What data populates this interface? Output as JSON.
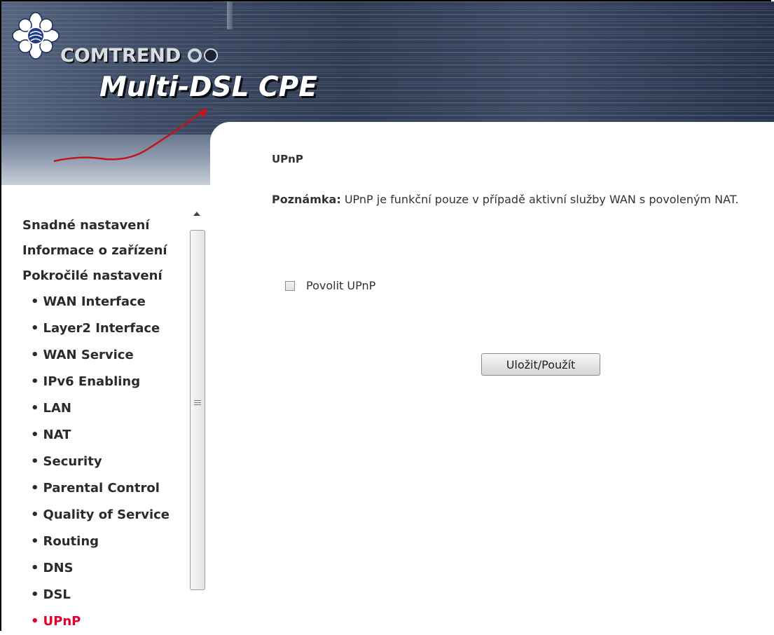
{
  "header": {
    "brand": "COMTREND",
    "product": "Multi-DSL CPE"
  },
  "sidebar": {
    "items": [
      {
        "label": "Snadné nastavení",
        "level": "top"
      },
      {
        "label": "Informace o zařízení",
        "level": "top"
      },
      {
        "label": "Pokročilé nastavení",
        "level": "top"
      },
      {
        "label": "WAN Interface",
        "level": "sub"
      },
      {
        "label": "Layer2 Interface",
        "level": "sub"
      },
      {
        "label": "WAN Service",
        "level": "sub"
      },
      {
        "label": "IPv6 Enabling",
        "level": "sub"
      },
      {
        "label": "LAN",
        "level": "sub"
      },
      {
        "label": "NAT",
        "level": "sub"
      },
      {
        "label": "Security",
        "level": "sub"
      },
      {
        "label": "Parental Control",
        "level": "sub"
      },
      {
        "label": "Quality of Service",
        "level": "sub"
      },
      {
        "label": "Routing",
        "level": "sub"
      },
      {
        "label": "DNS",
        "level": "sub"
      },
      {
        "label": "DSL",
        "level": "sub"
      },
      {
        "label": "UPnP",
        "level": "sub",
        "active": true
      }
    ],
    "bullet": "•"
  },
  "main": {
    "title": "UPnP",
    "note_label": "Poznámka:",
    "note_text": " UPnP je funkční pouze v případě aktivní služby WAN s povoleným NAT.",
    "checkbox_label": "Povolit UPnP",
    "checkbox_checked": false,
    "save_button": "Uložit/Použít"
  },
  "colors": {
    "active_menu": "#e4002b",
    "text": "#333333"
  }
}
